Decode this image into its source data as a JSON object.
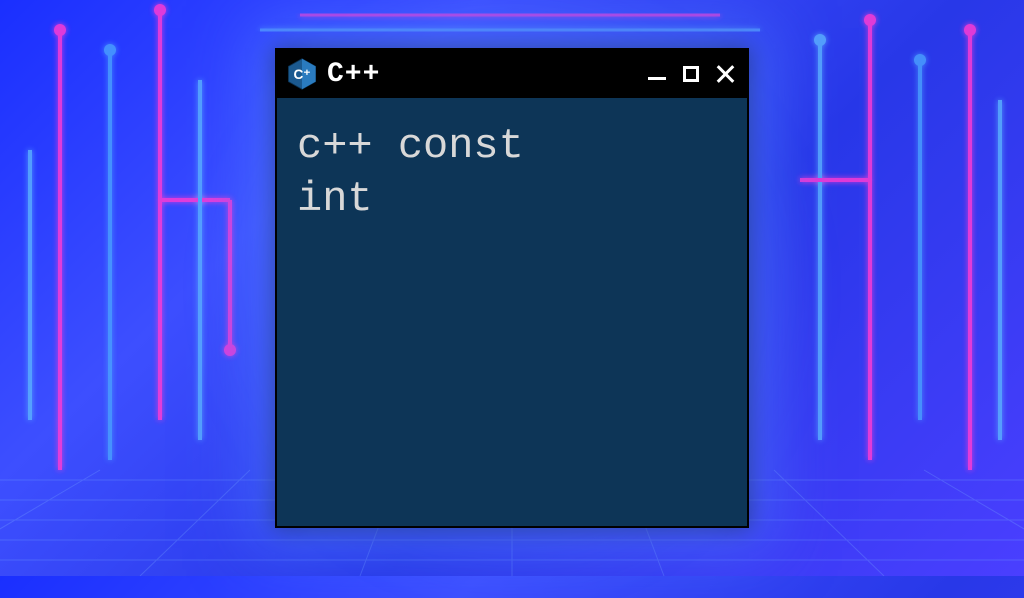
{
  "window": {
    "title": "C++",
    "logo": "cpp-logo",
    "content": "c++ const\nint"
  },
  "colors": {
    "window_bg": "#0d3557",
    "titlebar_bg": "#000000",
    "text": "#d8d8d8"
  }
}
